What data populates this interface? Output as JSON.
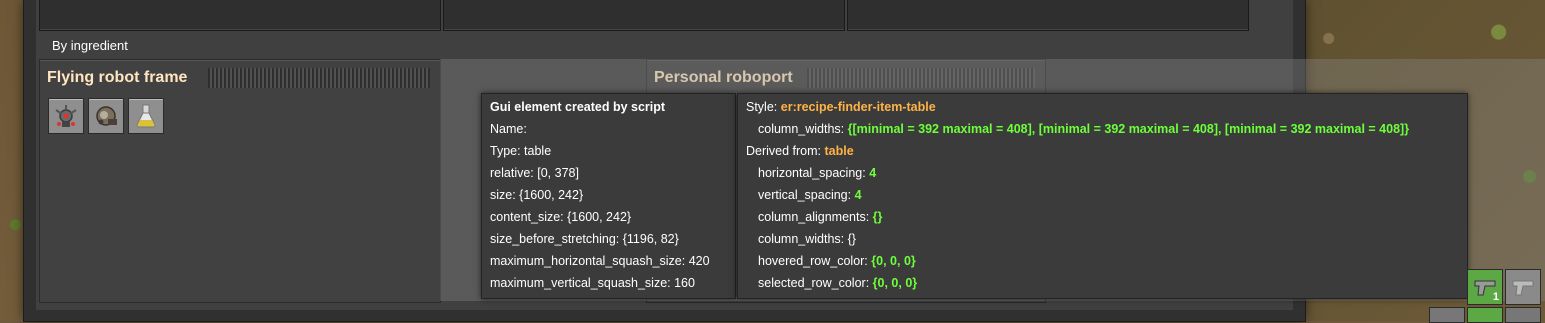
{
  "section": {
    "label": "By ingredient"
  },
  "cards": [
    {
      "title": "Flying robot frame"
    },
    {
      "title": "Personal roboport"
    }
  ],
  "items": [
    {
      "icon": "flying-robot-frame-icon"
    },
    {
      "icon": "electric-engine-icon"
    },
    {
      "icon": "lubricant-flask-icon"
    }
  ],
  "tooltip_left": {
    "title": "Gui element created by script",
    "lines": [
      "Name:",
      "Type: table",
      "relative: [0, 378]",
      "size: {1600, 242}",
      "content_size: {1600, 242}",
      "size_before_stretching: {1196, 82}",
      "maximum_horizontal_squash_size: 420",
      "maximum_vertical_squash_size: 160"
    ]
  },
  "tooltip_right": {
    "style_label": "Style:",
    "style_value": "er:recipe-finder-item-table",
    "column_widths_label": "column_widths:",
    "column_widths_value": "{[minimal = 392 maximal = 408], [minimal = 392 maximal = 408], [minimal = 392 maximal = 408]}",
    "derived_label": "Derived from:",
    "derived_value": "table",
    "props": [
      {
        "key": "horizontal_spacing:",
        "value": "4"
      },
      {
        "key": "vertical_spacing:",
        "value": "4"
      },
      {
        "key": "column_alignments:",
        "value": "{}"
      },
      {
        "key": "column_widths: {}",
        "value": ""
      },
      {
        "key": "hovered_row_color:",
        "value": "{0, 0, 0}"
      },
      {
        "key": "selected_row_color:",
        "value": "{0, 0, 0}"
      }
    ]
  },
  "quickbar": {
    "pistol_count": "1"
  },
  "colors": {
    "accent_orange": "#ffb347",
    "value_green": "#6dff3a",
    "title_text": "#ffe6c0"
  }
}
